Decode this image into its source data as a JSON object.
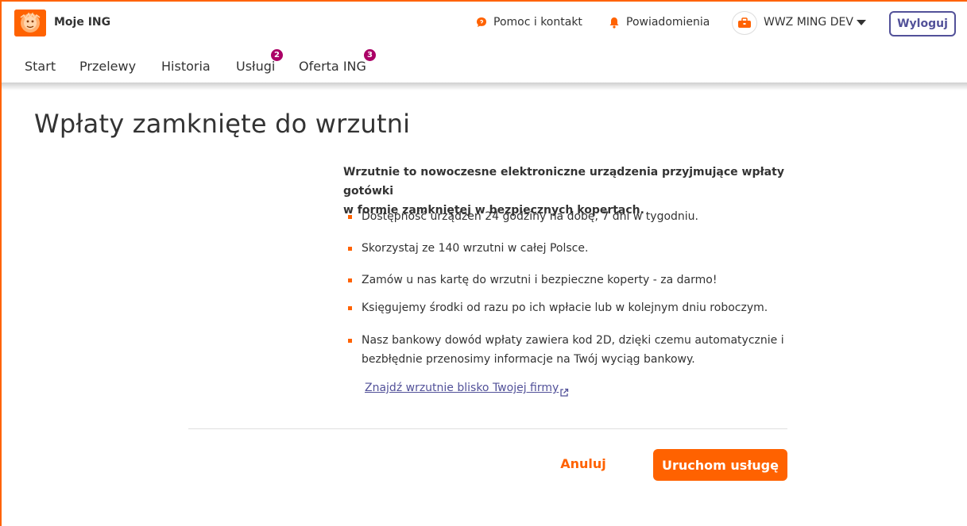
{
  "header": {
    "brand": "Moje ING",
    "help": "Pomoc i kontakt",
    "notifications": "Powiadomienia",
    "user_name": "WWZ MING DEV",
    "logout": "Wyloguj"
  },
  "nav": {
    "items": [
      {
        "label": "Start"
      },
      {
        "label": "Przelewy"
      },
      {
        "label": "Historia"
      },
      {
        "label": "Usługi",
        "badge": "2"
      },
      {
        "label": "Oferta ING",
        "badge": "3"
      }
    ]
  },
  "main": {
    "title": "Wpłaty zamknięte do wrzutni",
    "intro_line1": "Wrzutnie to nowoczesne elektroniczne urządzenia przyjmujące wpłaty gotówki",
    "intro_line2": "w formie zamkniętej w bezpiecznych kopertach.",
    "bullets": [
      "Dostępność urządzeń 24 godziny na dobę, 7 dni w tygodniu.",
      "Skorzystaj ze 140 wrzutni w całej Polsce.",
      "Zamów u nas kartę do wrzutni i bezpieczne koperty - za darmo!",
      "Księgujemy środki od razu po ich wpłacie lub w kolejnym dniu roboczym.",
      "Nasz bankowy dowód wpłaty zawiera kod 2D, dzięki czemu automatycznie i"
    ],
    "bullet5_line2": "bezbłędnie przenosimy informacje na Twój wyciąg bankowy.",
    "link": "Znajdź wrzutnie blisko Twojej firmy",
    "cancel": "Anuluj",
    "submit": "Uruchom usługę"
  },
  "colors": {
    "accent": "#ff6200",
    "link": "#525199",
    "badge": "#ab0066"
  }
}
